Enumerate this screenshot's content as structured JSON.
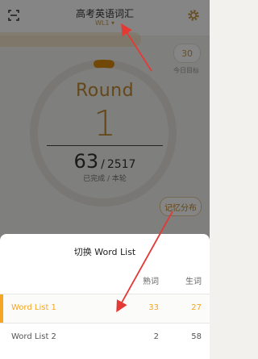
{
  "header": {
    "title": "高考英语词汇",
    "subtitle": "WL1 ▾",
    "icons": {
      "left": "scan-icon",
      "right": "gear-icon"
    }
  },
  "stats": {
    "badge_value": "30",
    "badge_label": "今日目标"
  },
  "ring": {
    "label": "Round",
    "number": "1",
    "done": "63",
    "total": "2517",
    "sub": "已完成 / 本轮"
  },
  "buttons": {
    "distribution": "记忆分布"
  },
  "sheet": {
    "title": "切换 Word List",
    "columns": {
      "known": "熟词",
      "unknown": "生词"
    },
    "lists": [
      {
        "name": "Word List 1",
        "known": "33",
        "unknown": "27",
        "selected": true
      },
      {
        "name": "Word List 2",
        "known": "2",
        "unknown": "58",
        "selected": false
      }
    ]
  },
  "colors": {
    "accent": "#f5a623",
    "gold": "#c08a30",
    "overlay": "#000000",
    "annotation_arrow": "#e53935"
  }
}
